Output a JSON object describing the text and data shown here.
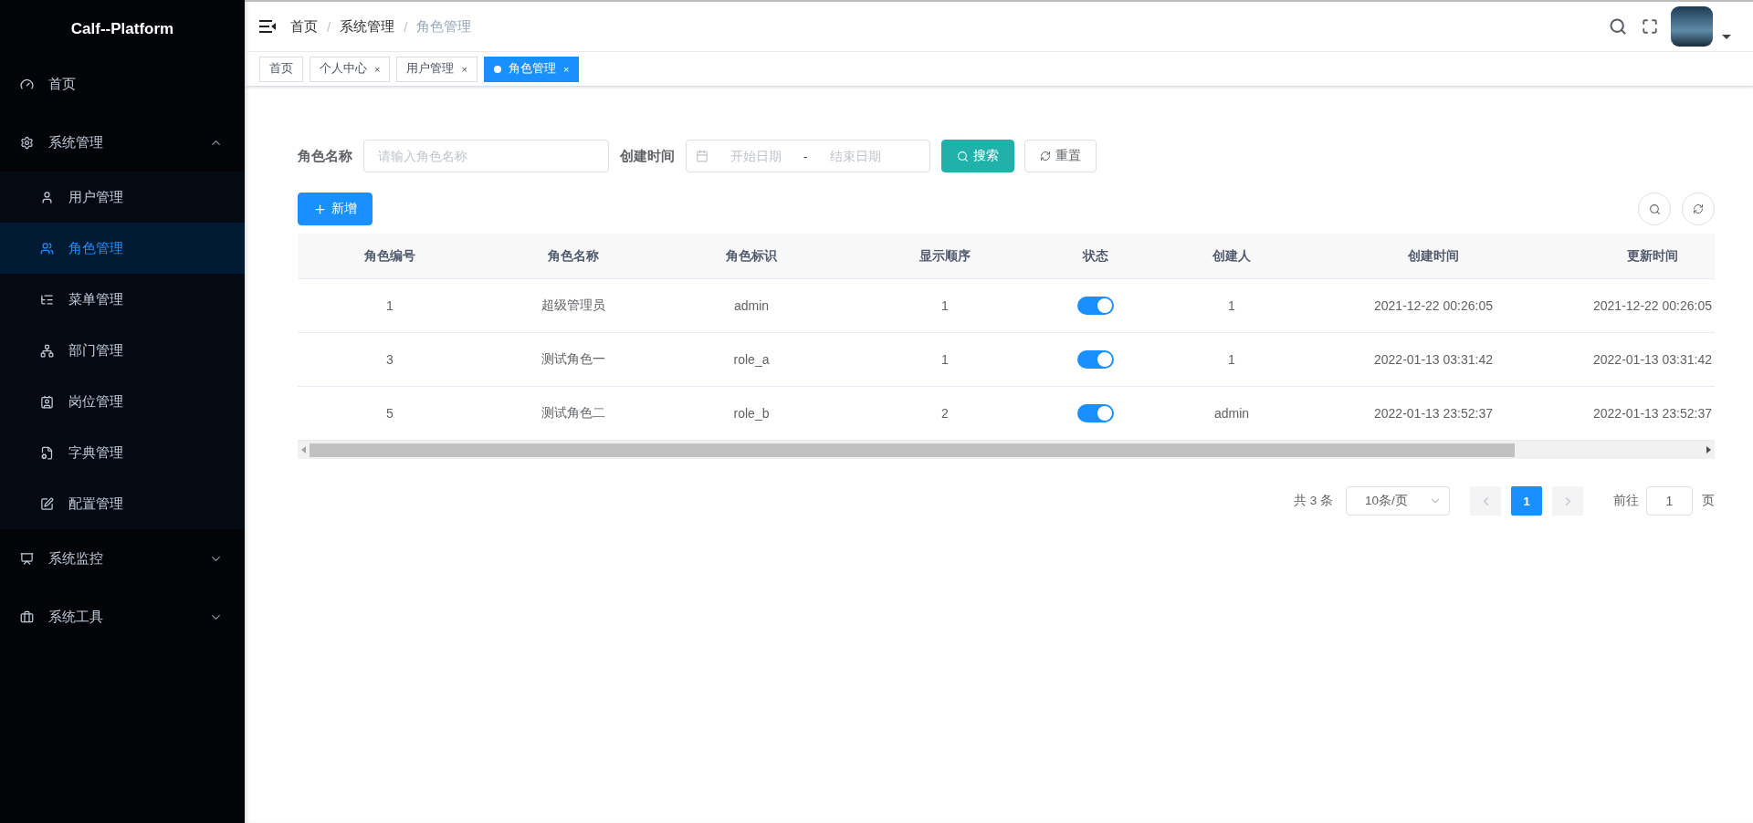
{
  "sidebar": {
    "logo": "Calf--Platform",
    "items": [
      {
        "label": "首页",
        "selected": false
      },
      {
        "label": "系统管理",
        "selected": false,
        "expanded": true,
        "children": [
          {
            "label": "用户管理",
            "selected": false
          },
          {
            "label": "角色管理",
            "selected": true
          },
          {
            "label": "菜单管理",
            "selected": false
          },
          {
            "label": "部门管理",
            "selected": false
          },
          {
            "label": "岗位管理",
            "selected": false
          },
          {
            "label": "字典管理",
            "selected": false
          },
          {
            "label": "配置管理",
            "selected": false
          }
        ]
      },
      {
        "label": "系统监控",
        "selected": false,
        "expanded": false
      },
      {
        "label": "系统工具",
        "selected": false,
        "expanded": false
      }
    ]
  },
  "breadcrumb": [
    "首页",
    "系统管理",
    "角色管理"
  ],
  "breadcrumb_separator": "/",
  "tabs": [
    {
      "label": "首页",
      "selected": false,
      "closable": false
    },
    {
      "label": "个人中心",
      "selected": false,
      "closable": true
    },
    {
      "label": "用户管理",
      "selected": false,
      "closable": true
    },
    {
      "label": "角色管理",
      "selected": true,
      "closable": true
    }
  ],
  "tab_close": "×",
  "filters": {
    "role_name": {
      "label": "角色名称",
      "placeholder": "请输入角色名称"
    },
    "created": {
      "label": "创建时间",
      "start_placeholder": "开始日期",
      "separator": "-",
      "end_placeholder": "结束日期"
    },
    "search_button": "搜索",
    "reset_button": "重置"
  },
  "add_button": "新增",
  "table": {
    "columns": [
      "角色编号",
      "角色名称",
      "角色标识",
      "显示顺序",
      "状态",
      "创建人",
      "创建时间",
      "更新时间"
    ],
    "rows": [
      {
        "id": "1",
        "name": "超级管理员",
        "key": "admin",
        "order": "1",
        "on": true,
        "creator": "1",
        "created": "2021-12-22 00:26:05",
        "updated": "2021-12-22 00:26:05"
      },
      {
        "id": "3",
        "name": "测试角色一",
        "key": "role_a",
        "order": "1",
        "on": true,
        "creator": "1",
        "created": "2022-01-13 03:31:42",
        "updated": "2022-01-13 03:31:42"
      },
      {
        "id": "5",
        "name": "测试角色二",
        "key": "role_b",
        "order": "2",
        "on": true,
        "creator": "admin",
        "created": "2022-01-13 23:52:37",
        "updated": "2022-01-13 23:52:37"
      }
    ]
  },
  "pagination": {
    "total": "共 3 条",
    "page_size": "10条/页",
    "pages": [
      {
        "label": "1",
        "selected": true
      }
    ],
    "goto_label": "前往",
    "goto_value": "1",
    "goto_suffix": "页"
  }
}
